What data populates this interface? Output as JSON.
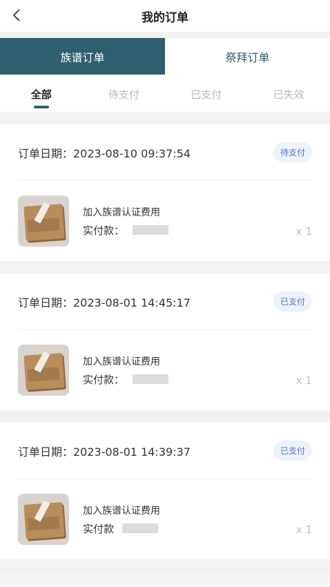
{
  "header": {
    "title": "我的订单",
    "back_icon": "chevron-left-icon"
  },
  "main_tabs": [
    {
      "label": "族谱订单",
      "active": true
    },
    {
      "label": "祭拜订单",
      "active": false
    }
  ],
  "sub_tabs": [
    {
      "label": "全部",
      "active": true
    },
    {
      "label": "待支付",
      "active": false
    },
    {
      "label": "已支付",
      "active": false
    },
    {
      "label": "已失效",
      "active": false
    }
  ],
  "orders": [
    {
      "date": "订单日期：2023-08-10 09:37:54",
      "status": "待支付",
      "product": "加入族谱认证费用",
      "price_label": "实付款：",
      "qty": "x 1"
    },
    {
      "date": "订单日期：2023-08-01 14:45:17",
      "status": "已支付",
      "product": "加入族谱认证费用",
      "price_label": "实付款：",
      "qty": "x 1"
    },
    {
      "date": "订单日期：2023-08-01 14:39:37",
      "status": "已支付",
      "product": "加入族谱认证费用",
      "price_label": "实付款",
      "qty": "x 1"
    }
  ],
  "colors": {
    "primary": "#2e5f6e",
    "badge_text": "#5a76c6",
    "badge_bg": "#eef2fb"
  }
}
